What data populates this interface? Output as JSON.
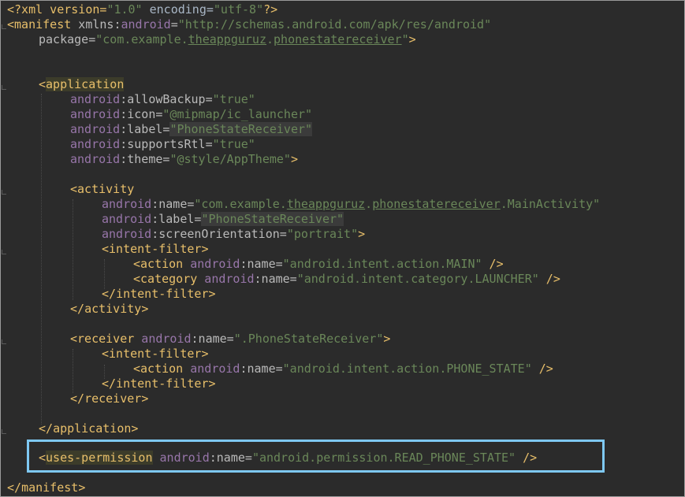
{
  "code": {
    "l1": {
      "a": "<?xml version=",
      "b": "\"1.0\"",
      "c": " encoding=",
      "d": "\"utf-8\"",
      "e": "?>"
    },
    "l2": {
      "open": "<",
      "tag": "manifest",
      "attr": " xmlns:",
      "ns": "android",
      "eq": "=",
      "val": "\"http://schemas.android.com/apk/res/android\""
    },
    "l3": {
      "attr": "package=",
      "q1": "\"com.example.",
      "u1": "theappguruz",
      "dot": ".",
      "u2": "phonestatereceiver",
      "q2": "\"",
      "close": ">"
    },
    "l4": {
      "open": "<",
      "tag": "application"
    },
    "l5": {
      "ns": "android",
      "attr": ":allowBackup=",
      "val": "\"true\""
    },
    "l6": {
      "ns": "android",
      "attr": ":icon=",
      "val": "\"@mipmap/ic_launcher\""
    },
    "l7": {
      "ns": "android",
      "attr": ":label=",
      "val": "\"PhoneStateReceiver\""
    },
    "l8": {
      "ns": "android",
      "attr": ":supportsRtl=",
      "val": "\"true\""
    },
    "l9": {
      "ns": "android",
      "attr": ":theme=",
      "val": "\"@style/AppTheme\"",
      "close": ">"
    },
    "l10": {
      "open": "<",
      "tag": "activity"
    },
    "l11": {
      "ns": "android",
      "attr": ":name=",
      "q1": "\"com.example.",
      "u1": "theappguruz",
      "dot1": ".",
      "u2": "phonestatereceiver",
      "rest": ".MainActivity\""
    },
    "l12": {
      "ns": "android",
      "attr": ":label=",
      "val": "\"PhoneStateReceiver\""
    },
    "l13": {
      "ns": "android",
      "attr": ":screenOrientation=",
      "val": "\"portrait\"",
      "close": ">"
    },
    "l14": {
      "open": "<",
      "tag": "intent-filter",
      "close": ">"
    },
    "l15": {
      "open": "<",
      "tag": "action",
      "ns": " android",
      "attr": ":name=",
      "val": "\"android.intent.action.MAIN\"",
      "close": " />"
    },
    "l16": {
      "open": "<",
      "tag": "category",
      "ns": " android",
      "attr": ":name=",
      "val": "\"android.intent.category.LAUNCHER\"",
      "close": " />"
    },
    "l17": {
      "open": "</",
      "tag": "intent-filter",
      "close": ">"
    },
    "l18": {
      "open": "</",
      "tag": "activity",
      "close": ">"
    },
    "l19": {
      "open": "<",
      "tag": "receiver",
      "ns": " android",
      "attr": ":name=",
      "val": "\".PhoneStateReceiver\"",
      "close": ">"
    },
    "l20": {
      "open": "<",
      "tag": "intent-filter",
      "close": ">"
    },
    "l21": {
      "open": "<",
      "tag": "action",
      "ns": " android",
      "attr": ":name=",
      "val": "\"android.intent.action.PHONE_STATE\"",
      "close": " />"
    },
    "l22": {
      "open": "</",
      "tag": "intent-filter",
      "close": ">"
    },
    "l23": {
      "open": "</",
      "tag": "receiver",
      "close": ">"
    },
    "l24": {
      "open": "</",
      "tag": "application",
      "close": ">"
    },
    "l25": {
      "open": "<",
      "tag": "uses-permission",
      "ns": " android",
      "attr": ":name=",
      "val": "\"android.permission.READ_PHONE_STATE\"",
      "close": " />"
    },
    "l26": {
      "open": "</",
      "tag": "manifest",
      "close": ">"
    }
  },
  "colors": {
    "background": "#2b2b2b",
    "tag": "#e8bf6a",
    "namespace": "#9876aa",
    "attribute": "#bababa",
    "value": "#6a8759",
    "highlight_border": "#7ec8f2"
  }
}
